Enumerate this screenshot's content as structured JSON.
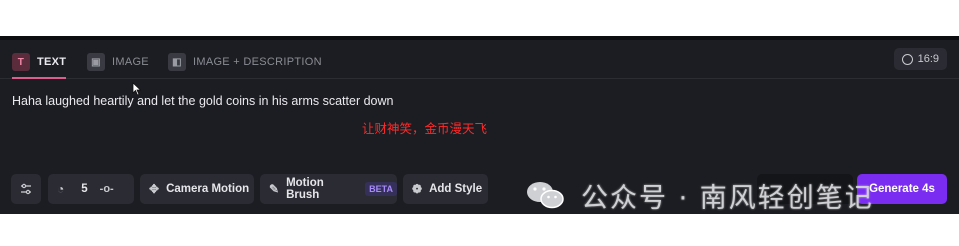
{
  "tabs": [
    {
      "label": "TEXT",
      "icon": "text-icon",
      "glyph": "T",
      "active": true
    },
    {
      "label": "IMAGE",
      "icon": "image-icon",
      "glyph": "▣",
      "active": false
    },
    {
      "label": "IMAGE + DESCRIPTION",
      "icon": "image-description-icon",
      "glyph": "◧",
      "active": false
    }
  ],
  "aspect_ratio": {
    "label": "16:9",
    "icon": "aspect-ratio-icon"
  },
  "prompt": {
    "text": "Haha laughed heartily and let the gold coins in his arms scatter down"
  },
  "annotation": {
    "text": "让财神笑，金币漫天飞",
    "color": "#ff2a2a"
  },
  "toolbar": {
    "settings_icon": "sliders-icon",
    "motion_value": "5",
    "camera_motion_label": "Camera Motion",
    "motion_brush_label": "Motion Brush",
    "beta_label": "BETA",
    "add_style_label": "Add Style",
    "generate_label": "Generate 4s"
  },
  "watermark": {
    "text": "公众号 · 南风轻创笔记"
  },
  "colors": {
    "accent": "#e05c8a",
    "generate": "#7a2cf0",
    "background": "#1c1d22"
  }
}
